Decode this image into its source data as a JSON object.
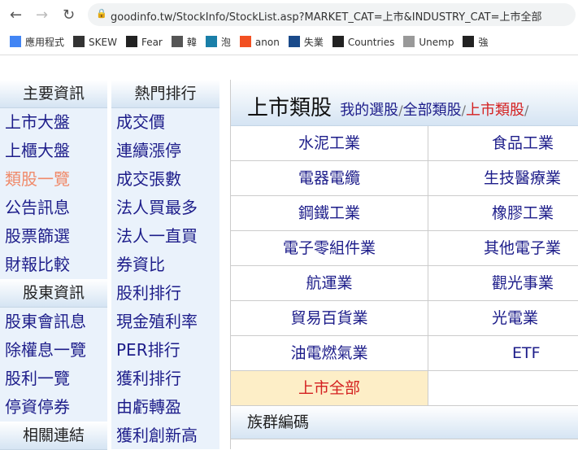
{
  "browser": {
    "url": "goodinfo.tw/StockInfo/StockList.asp?MARKET_CAT=上市&INDUSTRY_CAT=上市全部",
    "bookmarks": [
      {
        "label": "應用程式",
        "icon": "apps-icon",
        "color": "#4285f4"
      },
      {
        "label": "SKEW",
        "icon": "inv-icon",
        "color": "#333"
      },
      {
        "label": "Fear",
        "icon": "triangle-icon",
        "color": "#222"
      },
      {
        "label": "韓",
        "icon": "globe-icon",
        "color": "#555"
      },
      {
        "label": "泡",
        "icon": "eth-icon",
        "color": "#1a7fa8"
      },
      {
        "label": "anon",
        "icon": "microsoft-icon",
        "color": "#f25022"
      },
      {
        "label": "失業",
        "icon": "grid-icon",
        "color": "#1a4a8a"
      },
      {
        "label": "Countries",
        "icon": "te-icon",
        "color": "#222"
      },
      {
        "label": "Unemp",
        "icon": "chart-icon",
        "color": "#999"
      },
      {
        "label": "強",
        "icon": "arch-icon",
        "color": "#222"
      }
    ]
  },
  "sidebar": {
    "main_header": "主要資訊",
    "main_items": [
      "上市大盤",
      "上櫃大盤",
      "類股一覽",
      "公告訊息",
      "股票篩選",
      "財報比較"
    ],
    "active_item": "類股一覽",
    "holder_header": "股東資訊",
    "holder_items": [
      "股東會訊息",
      "除權息一覽",
      "股利一覽",
      "停資停券"
    ],
    "links_header": "相關連結"
  },
  "hot": {
    "header": "熱門排行",
    "items": [
      "成交價",
      "連續漲停",
      "成交張數",
      "法人買最多",
      "法人一直買",
      "券資比",
      "股利排行",
      "現金殖利率",
      "PER排行",
      "獲利排行",
      "由虧轉盈",
      "獲利創新高"
    ]
  },
  "main": {
    "title": "上市類股",
    "links": [
      "我的選股",
      "全部類股",
      "上市類股"
    ],
    "active_link": "上市類股",
    "categories": [
      "水泥工業",
      "食品工業",
      "電器電纜",
      "生技醫療業",
      "鋼鐵工業",
      "橡膠工業",
      "電子零組件業",
      "其他電子業",
      "航運業",
      "觀光事業",
      "貿易百貨業",
      "光電業",
      "油電燃氣業",
      "ETF",
      "上市全部",
      ""
    ],
    "selected": "上市全部",
    "group_header": "族群編碼"
  }
}
